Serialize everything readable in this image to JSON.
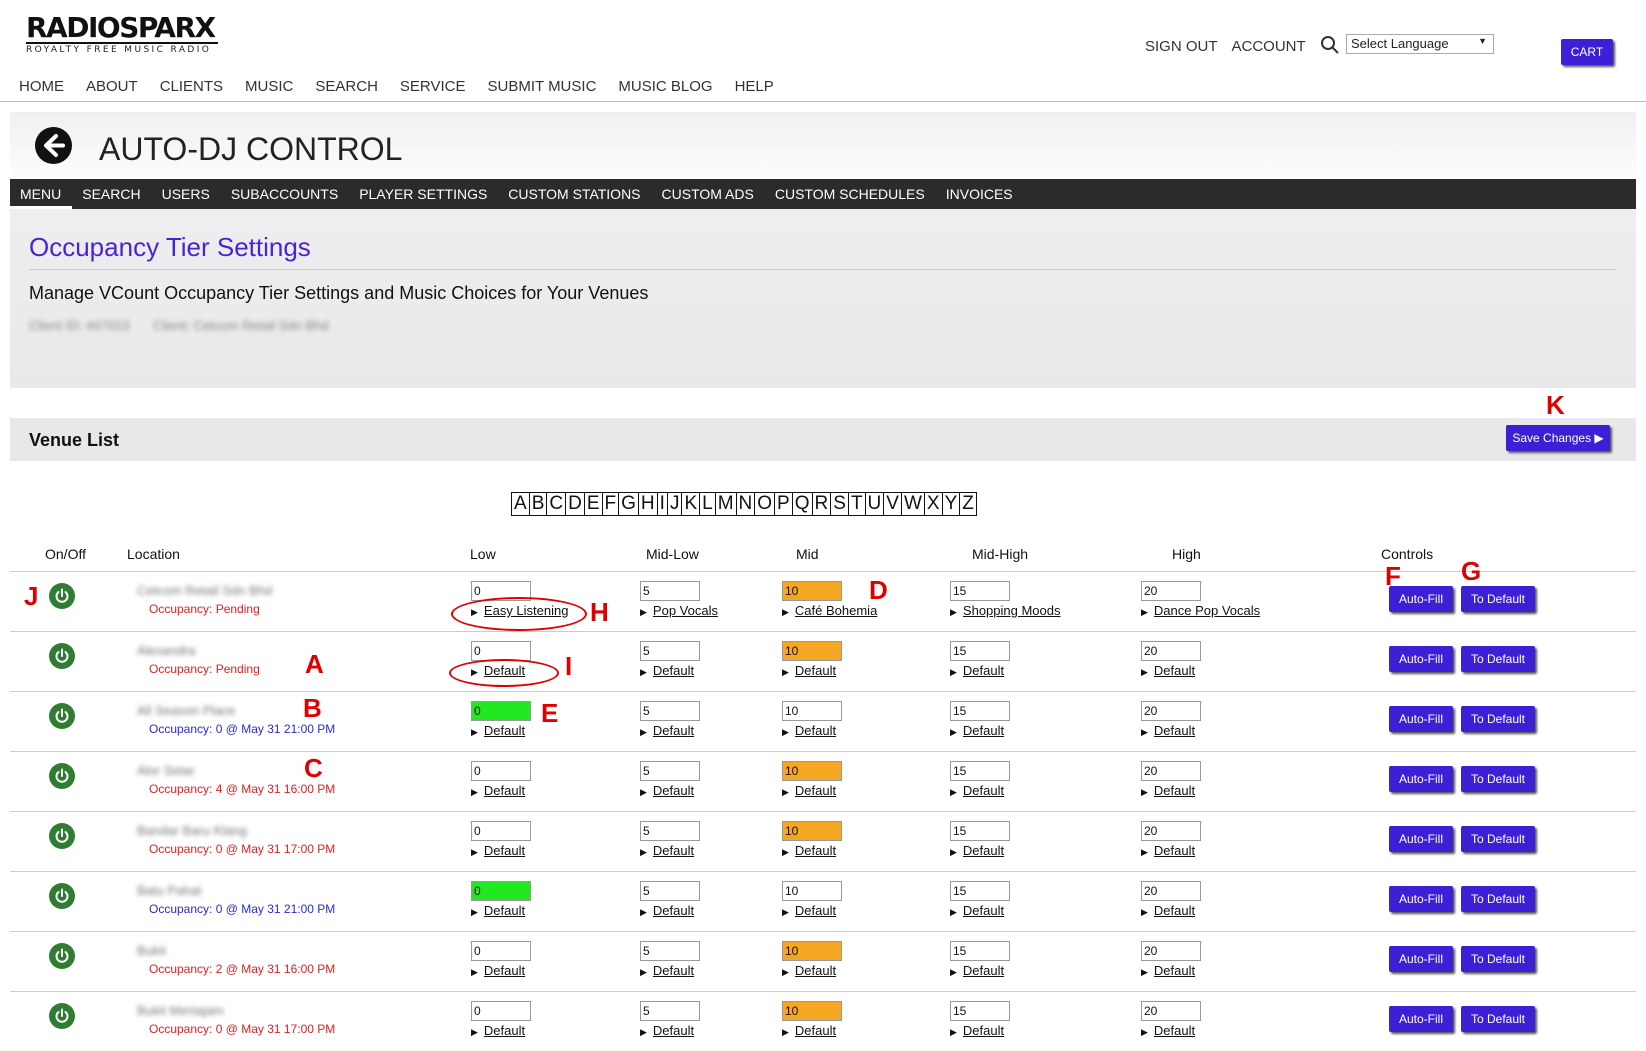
{
  "brand": {
    "name": "RADIOSPARX",
    "tagline": "ROYALTY FREE MUSIC RADIO"
  },
  "top_links": {
    "sign_out": "SIGN OUT",
    "account": "ACCOUNT",
    "language": "Select Language",
    "cart": "CART"
  },
  "main_nav": [
    "HOME",
    "ABOUT",
    "CLIENTS",
    "MUSIC",
    "SEARCH",
    "SERVICE",
    "SUBMIT MUSIC",
    "MUSIC BLOG",
    "HELP"
  ],
  "page_title": "AUTO-DJ CONTROL",
  "sub_nav": [
    "MENU",
    "SEARCH",
    "USERS",
    "SUBACCOUNTS",
    "PLAYER SETTINGS",
    "CUSTOM STATIONS",
    "CUSTOM ADS",
    "CUSTOM SCHEDULES",
    "INVOICES"
  ],
  "settings": {
    "title": "Occupancy Tier Settings",
    "subtitle": "Manage VCount Occupancy Tier Settings and Music Choices for Your Venues",
    "client_id": "Client ID: 447023",
    "client_name": "Client: Cetcom Retail Sdn Bhd"
  },
  "venue_list": {
    "title": "Venue List",
    "save_label": "Save Changes ▶"
  },
  "letters": [
    "A",
    "B",
    "C",
    "D",
    "E",
    "F",
    "G",
    "H",
    "I",
    "J",
    "K",
    "L",
    "M",
    "N",
    "O",
    "P",
    "Q",
    "R",
    "S",
    "T",
    "U",
    "V",
    "W",
    "X",
    "Y",
    "Z"
  ],
  "table": {
    "headers": [
      "On/Off",
      "Location",
      "Low",
      "Mid-Low",
      "Mid",
      "Mid-High",
      "High",
      "Controls"
    ],
    "autofill_label": "Auto-Fill",
    "todefault_label": "To Default",
    "rows": [
      {
        "name": "Cetcom Retail Sdn Bhd",
        "occupancy": "Occupancy: Pending",
        "occ_color": "red",
        "tiers": [
          {
            "value": "0",
            "link": "Easy Listening",
            "hl": ""
          },
          {
            "value": "5",
            "link": "Pop Vocals",
            "hl": ""
          },
          {
            "value": "10",
            "link": "Café Bohemia",
            "hl": "orange"
          },
          {
            "value": "15",
            "link": "Shopping Moods",
            "hl": ""
          },
          {
            "value": "20",
            "link": "Dance Pop Vocals",
            "hl": ""
          }
        ]
      },
      {
        "name": "Alexandra",
        "occupancy": "Occupancy: Pending",
        "occ_color": "red",
        "tiers": [
          {
            "value": "0",
            "link": "Default",
            "hl": ""
          },
          {
            "value": "5",
            "link": "Default",
            "hl": ""
          },
          {
            "value": "10",
            "link": "Default",
            "hl": "orange"
          },
          {
            "value": "15",
            "link": "Default",
            "hl": ""
          },
          {
            "value": "20",
            "link": "Default",
            "hl": ""
          }
        ]
      },
      {
        "name": "All Season Place",
        "occupancy": "Occupancy: 0 @ May 31 21:00 PM",
        "occ_color": "blue",
        "tiers": [
          {
            "value": "0",
            "link": "Default",
            "hl": "green"
          },
          {
            "value": "5",
            "link": "Default",
            "hl": ""
          },
          {
            "value": "10",
            "link": "Default",
            "hl": ""
          },
          {
            "value": "15",
            "link": "Default",
            "hl": ""
          },
          {
            "value": "20",
            "link": "Default",
            "hl": ""
          }
        ]
      },
      {
        "name": "Alor Setar",
        "occupancy": "Occupancy: 4 @ May 31 16:00 PM",
        "occ_color": "red",
        "tiers": [
          {
            "value": "0",
            "link": "Default",
            "hl": ""
          },
          {
            "value": "5",
            "link": "Default",
            "hl": ""
          },
          {
            "value": "10",
            "link": "Default",
            "hl": "orange"
          },
          {
            "value": "15",
            "link": "Default",
            "hl": ""
          },
          {
            "value": "20",
            "link": "Default",
            "hl": ""
          }
        ]
      },
      {
        "name": "Bandar Baru Klang",
        "occupancy": "Occupancy: 0 @ May 31 17:00 PM",
        "occ_color": "red",
        "tiers": [
          {
            "value": "0",
            "link": "Default",
            "hl": ""
          },
          {
            "value": "5",
            "link": "Default",
            "hl": ""
          },
          {
            "value": "10",
            "link": "Default",
            "hl": "orange"
          },
          {
            "value": "15",
            "link": "Default",
            "hl": ""
          },
          {
            "value": "20",
            "link": "Default",
            "hl": ""
          }
        ]
      },
      {
        "name": "Batu Pahat",
        "occupancy": "Occupancy: 0 @ May 31 21:00 PM",
        "occ_color": "blue",
        "tiers": [
          {
            "value": "0",
            "link": "Default",
            "hl": "green"
          },
          {
            "value": "5",
            "link": "Default",
            "hl": ""
          },
          {
            "value": "10",
            "link": "Default",
            "hl": ""
          },
          {
            "value": "15",
            "link": "Default",
            "hl": ""
          },
          {
            "value": "20",
            "link": "Default",
            "hl": ""
          }
        ]
      },
      {
        "name": "Bukit",
        "occupancy": "Occupancy: 2 @ May 31 16:00 PM",
        "occ_color": "red",
        "tiers": [
          {
            "value": "0",
            "link": "Default",
            "hl": ""
          },
          {
            "value": "5",
            "link": "Default",
            "hl": ""
          },
          {
            "value": "10",
            "link": "Default",
            "hl": "orange"
          },
          {
            "value": "15",
            "link": "Default",
            "hl": ""
          },
          {
            "value": "20",
            "link": "Default",
            "hl": ""
          }
        ]
      },
      {
        "name": "Bukit Mertajam",
        "occupancy": "Occupancy: 0 @ May 31 17:00 PM",
        "occ_color": "red",
        "tiers": [
          {
            "value": "0",
            "link": "Default",
            "hl": ""
          },
          {
            "value": "5",
            "link": "Default",
            "hl": ""
          },
          {
            "value": "10",
            "link": "Default",
            "hl": "orange"
          },
          {
            "value": "15",
            "link": "Default",
            "hl": ""
          },
          {
            "value": "20",
            "link": "Default",
            "hl": ""
          }
        ]
      }
    ]
  },
  "annotations": [
    "A",
    "B",
    "C",
    "D",
    "E",
    "F",
    "G",
    "H",
    "I",
    "J",
    "K"
  ],
  "colors": {
    "accent": "#3d20d6",
    "title": "#4a23d2",
    "power": "#2e7d32",
    "mid_highlight": "#f5a623",
    "low_highlight": "#22e822",
    "annotation": "#e00000"
  }
}
